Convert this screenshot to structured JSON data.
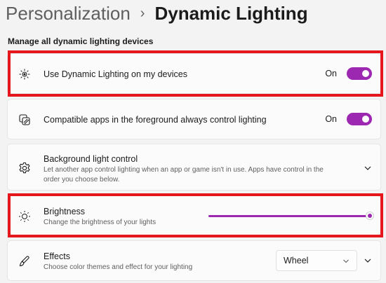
{
  "breadcrumb": {
    "parent": "Personalization",
    "separator": "›",
    "current": "Dynamic Lighting"
  },
  "section": {
    "title": "Manage all dynamic lighting devices"
  },
  "settings": [
    {
      "icon": "dynamic-lighting-icon",
      "title": "Use Dynamic Lighting on my devices",
      "control": "toggle",
      "state_label": "On"
    },
    {
      "icon": "apps-lighting-icon",
      "title": "Compatible apps in the foreground always control lighting",
      "control": "toggle",
      "state_label": "On"
    },
    {
      "icon": "gear-icon",
      "title": "Background light control",
      "description": "Let another app control lighting when an app or game isn't in use. Apps have control in the order you choose below.",
      "control": "expand"
    },
    {
      "icon": "brightness-icon",
      "title": "Brightness",
      "description": "Change the brightness of your lights",
      "control": "slider",
      "value": 100
    },
    {
      "icon": "brush-icon",
      "title": "Effects",
      "description": "Choose color themes and effect for your lighting",
      "control": "dropdown",
      "selected": "Wheel"
    }
  ],
  "colors": {
    "accent": "#9c27b0",
    "highlight": "#e5161c"
  }
}
